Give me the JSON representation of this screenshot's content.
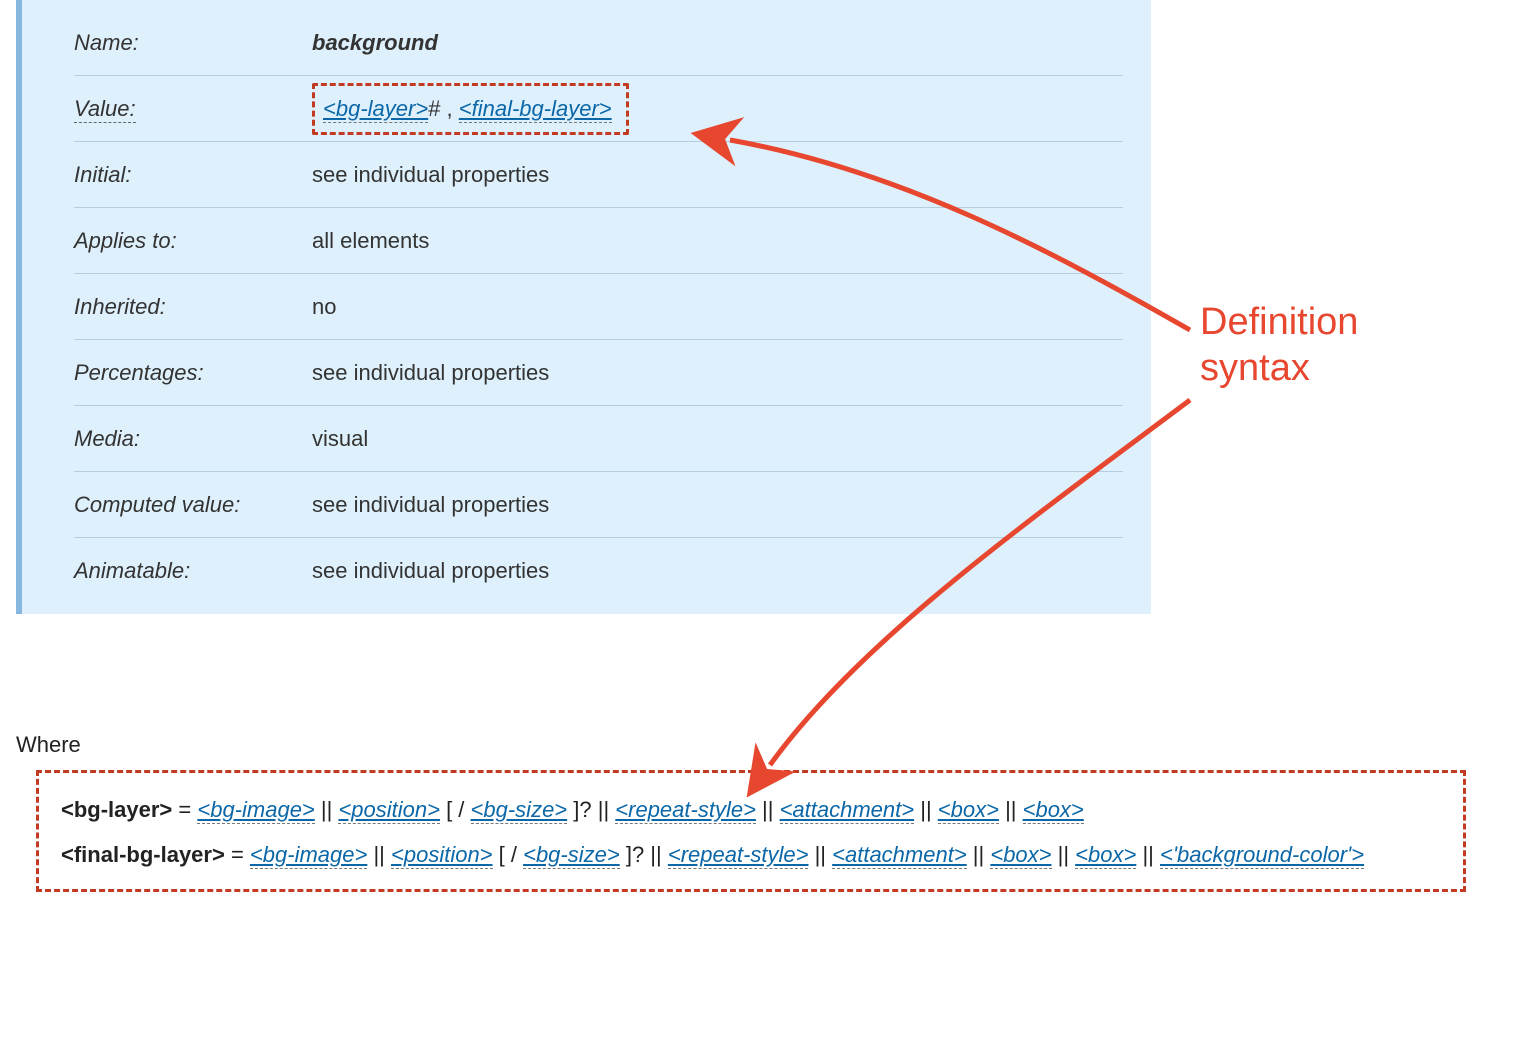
{
  "annotation": {
    "line1": "Definition",
    "line2": "syntax"
  },
  "property_def": {
    "rows": [
      {
        "label_ital": "Name:",
        "value_type": "name",
        "value": "background"
      },
      {
        "label_udash": "Value:",
        "value_type": "value",
        "link1": "<bg-layer>",
        "sep": "# , ",
        "link2": "<final-bg-layer>"
      },
      {
        "label_ital": "Initial:",
        "value_type": "plain",
        "value": "see individual properties"
      },
      {
        "label_ital": "Applies to:",
        "value_type": "plain",
        "value": "all elements"
      },
      {
        "label_ital": "Inherited:",
        "value_type": "plain",
        "value": "no"
      },
      {
        "label_ital": "Percentages:",
        "value_type": "plain",
        "value": "see individual properties"
      },
      {
        "label_ital": "Media:",
        "value_type": "plain",
        "value": "visual"
      },
      {
        "label_ital": "Computed value:",
        "value_type": "plain",
        "value": "see individual properties"
      },
      {
        "label_ital": "Animatable:",
        "value_type": "plain",
        "value": "see individual properties"
      }
    ]
  },
  "where_label": "Where",
  "grammar": {
    "line1": {
      "lhs": "<bg-layer>",
      "eq": " = ",
      "t1": "<bg-image>",
      "s1": " || ",
      "t2": "<position>",
      "s2": " [ / ",
      "t3": "<bg-size>",
      "s3": " ]? || ",
      "t4": "<repeat-style>",
      "s4": " || ",
      "t5": "<attachment>",
      "s5": " || ",
      "t6": "<box>",
      "s6": " || ",
      "t7": "<box>"
    },
    "line2": {
      "lhs": "<final-bg-layer>",
      "eq": " = ",
      "t1": "<bg-image>",
      "s1": " || ",
      "t2": "<position>",
      "s2": " [ / ",
      "t3": "<bg-size>",
      "s3": " ]? || ",
      "t4": "<repeat-style>",
      "s4": " || ",
      "t5": "<attachment>",
      "s5": " || ",
      "t6": "<box>",
      "s6": " || ",
      "t7": "<box>",
      "s7": " || ",
      "t8": "<'background-color'>"
    }
  }
}
